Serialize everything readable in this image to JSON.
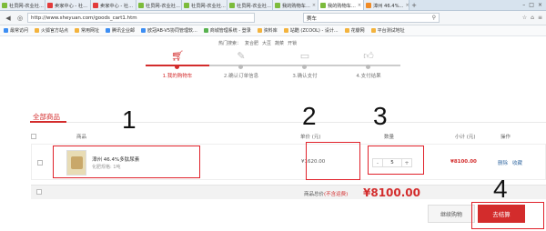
{
  "browser": {
    "tabs": [
      {
        "label": "社员网-农业社...",
        "active": false,
        "fav": "green"
      },
      {
        "label": "卖家中心 - 社...",
        "active": false,
        "fav": "red"
      },
      {
        "label": "卖家中心 - 社...",
        "active": false,
        "fav": "red"
      },
      {
        "label": "社员网-农业社...",
        "active": false,
        "fav": "green"
      },
      {
        "label": "社员网-农业社...",
        "active": false,
        "fav": "green"
      },
      {
        "label": "社员网-农业社...",
        "active": false,
        "fav": "green"
      },
      {
        "label": "我的购物车...",
        "active": false,
        "fav": "green"
      },
      {
        "label": "我的购物车...",
        "active": true,
        "fav": "green"
      },
      {
        "label": "漳州 46.4%...",
        "active": false,
        "fav": "orange"
      }
    ],
    "url": "http://www.sheyuan.com/goods_cart1.htm",
    "search_value": "赛车",
    "bookmarks": [
      "最常访问",
      "火狐官方站点",
      "常用网址",
      "腾讯企业邮",
      "欧冠AB-V5协同管理软...",
      "商城管理系统 - 登录",
      "资料库",
      "站酷 (ZCOOL) - 设计...",
      "花瓣网",
      "平台测试地址"
    ]
  },
  "hot_search": [
    "热门搜索：",
    "复合肥",
    "大豆",
    "蔬菜",
    "开锁"
  ],
  "steps": [
    {
      "label": "1.我的购物车",
      "icon": "cart-icon",
      "active": true
    },
    {
      "label": "2.确认订单信息",
      "icon": "pencil-icon",
      "active": false
    },
    {
      "label": "3.确认支付",
      "icon": "wallet-icon",
      "active": false
    },
    {
      "label": "4.支付结果",
      "icon": "thumbs-up-icon",
      "active": false
    }
  ],
  "section_title": "全部商品",
  "table": {
    "headers": {
      "product": "商品",
      "unit_price": "单价 (元)",
      "quantity": "数量",
      "subtotal": "小计 (元)",
      "actions": "操作"
    },
    "rows": [
      {
        "name": "漳州 46.4%多肽尿素",
        "spec": "化肥规格: 1吨",
        "price": "¥1620.00",
        "quantity": "5",
        "subtotal": "¥8100.00",
        "action_delete": "删除",
        "action_favorite": "收藏"
      }
    ]
  },
  "totals": {
    "label": "商品总价",
    "note": "(不含运费)",
    "amount": "¥8100.00"
  },
  "buttons": {
    "continue": "继续购物",
    "checkout": "去结算"
  },
  "annotations": [
    "1",
    "2",
    "3",
    "4"
  ],
  "colors": {
    "accent": "#d32c2c",
    "annotation": "#e0212a"
  }
}
